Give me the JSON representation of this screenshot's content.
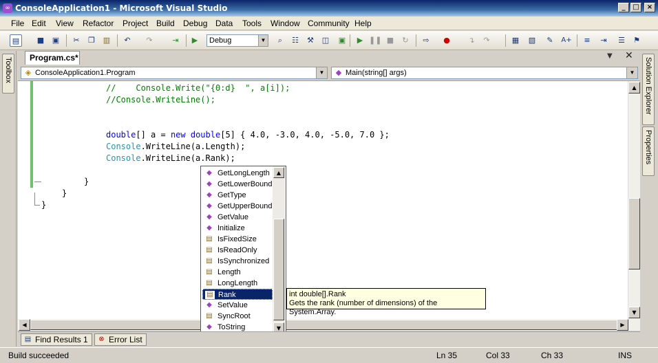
{
  "window": {
    "title": "ConsoleApplication1 - Microsoft Visual Studio"
  },
  "menu": [
    "File",
    "Edit",
    "View",
    "Refactor",
    "Project",
    "Build",
    "Debug",
    "Data",
    "Tools",
    "Window",
    "Community",
    "Help"
  ],
  "toolbar": {
    "configuration": "Debug"
  },
  "toolwindows": {
    "left": "Toolbox",
    "right_top": "Solution Explorer",
    "right_bottom": "Properties"
  },
  "document": {
    "tab": "Program.cs*",
    "nav_type": "ConsoleApplication1.Program",
    "nav_member": "Main(string[] args)"
  },
  "code": {
    "line1": [
      "//    Console.Write(\"{0:d}  \", a[i]);"
    ],
    "line2": [
      "//Console.WriteLine();"
    ],
    "line3": [
      "double",
      "[] a = ",
      "new",
      " ",
      "double",
      "[5] { 4.0, -3.0, 4.0, -5.0, 7.0 };"
    ],
    "line4": [
      "Console",
      ".WriteLine(a.Length);"
    ],
    "line5": [
      "Console",
      ".WriteLine(a.Rank);"
    ],
    "brace1": "}",
    "brace2": "}",
    "brace3": "}"
  },
  "intellisense": {
    "items": [
      {
        "label": "GetLongLength",
        "icon": "method-icon"
      },
      {
        "label": "GetLowerBound",
        "icon": "method-icon"
      },
      {
        "label": "GetType",
        "icon": "method-icon"
      },
      {
        "label": "GetUpperBound",
        "icon": "method-icon"
      },
      {
        "label": "GetValue",
        "icon": "method-icon"
      },
      {
        "label": "Initialize",
        "icon": "method-icon"
      },
      {
        "label": "IsFixedSize",
        "icon": "property-icon"
      },
      {
        "label": "IsReadOnly",
        "icon": "property-icon"
      },
      {
        "label": "IsSynchronized",
        "icon": "property-icon"
      },
      {
        "label": "Length",
        "icon": "property-icon"
      },
      {
        "label": "LongLength",
        "icon": "property-icon"
      },
      {
        "label": "Rank",
        "icon": "property-icon",
        "selected": true
      },
      {
        "label": "SetValue",
        "icon": "method-icon"
      },
      {
        "label": "SyncRoot",
        "icon": "property-icon"
      },
      {
        "label": "ToString",
        "icon": "method-icon"
      }
    ],
    "tooltip_signature": "int double[].Rank",
    "tooltip_description": "Gets the rank (number of dimensions) of the System.Array."
  },
  "bottom_tabs": [
    "Find Results 1",
    "Error List"
  ],
  "status": {
    "message": "Build succeeded",
    "line": "Ln 35",
    "col": "Col 33",
    "ch": "Ch 33",
    "mode": "INS"
  },
  "colors": {
    "keyword": "#0000ff",
    "comment": "#008000",
    "type": "#2b91af",
    "selection": "#0a246a",
    "change_margin": "#6cc36c"
  }
}
